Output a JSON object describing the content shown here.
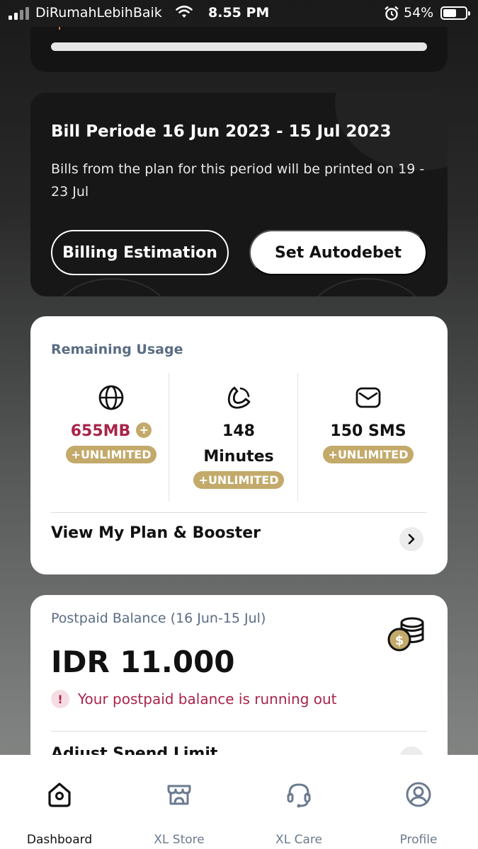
{
  "status_bar": {
    "carrier": "DiRumahLebihBaik",
    "time": "8.55 PM",
    "battery_percent": "54%"
  },
  "bill": {
    "title": "Bill Periode 16 Jun 2023 - 15 Jul 2023",
    "description": "Bills from the plan for this period will be printed on 19 - 23 Jul",
    "billing_estimation_label": "Billing Estimation",
    "autodebet_label": "Set Autodebet"
  },
  "usage": {
    "section_title": "Remaining Usage",
    "data": {
      "value": "655MB",
      "badge": "+UNLIMITED",
      "icon": "globe-icon",
      "color": "#a8244a"
    },
    "voice": {
      "value_line1": "148",
      "value_line2": "Minutes",
      "badge": "+UNLIMITED",
      "icon": "phone-icon"
    },
    "sms": {
      "value": "150 SMS",
      "badge": "+UNLIMITED",
      "icon": "mail-icon"
    },
    "plan_link": "View My Plan & Booster"
  },
  "balance": {
    "label": "Postpaid Balance (16 Jun-15 Jul)",
    "amount": "IDR 11.000",
    "warning": "Your postpaid balance is running out",
    "spend_link": "Adjust Spend Limit"
  },
  "nav": {
    "items": [
      {
        "label": "Dashboard",
        "icon": "home-icon",
        "active": true
      },
      {
        "label": "XL Store",
        "icon": "store-icon",
        "active": false
      },
      {
        "label": "XL Care",
        "icon": "headset-icon",
        "active": false
      },
      {
        "label": "Profile",
        "icon": "profile-icon",
        "active": false
      }
    ]
  },
  "colors": {
    "accent_gold": "#c3aa6b",
    "alert_red": "#a8244a",
    "label_blue_gray": "#5a6c84"
  }
}
